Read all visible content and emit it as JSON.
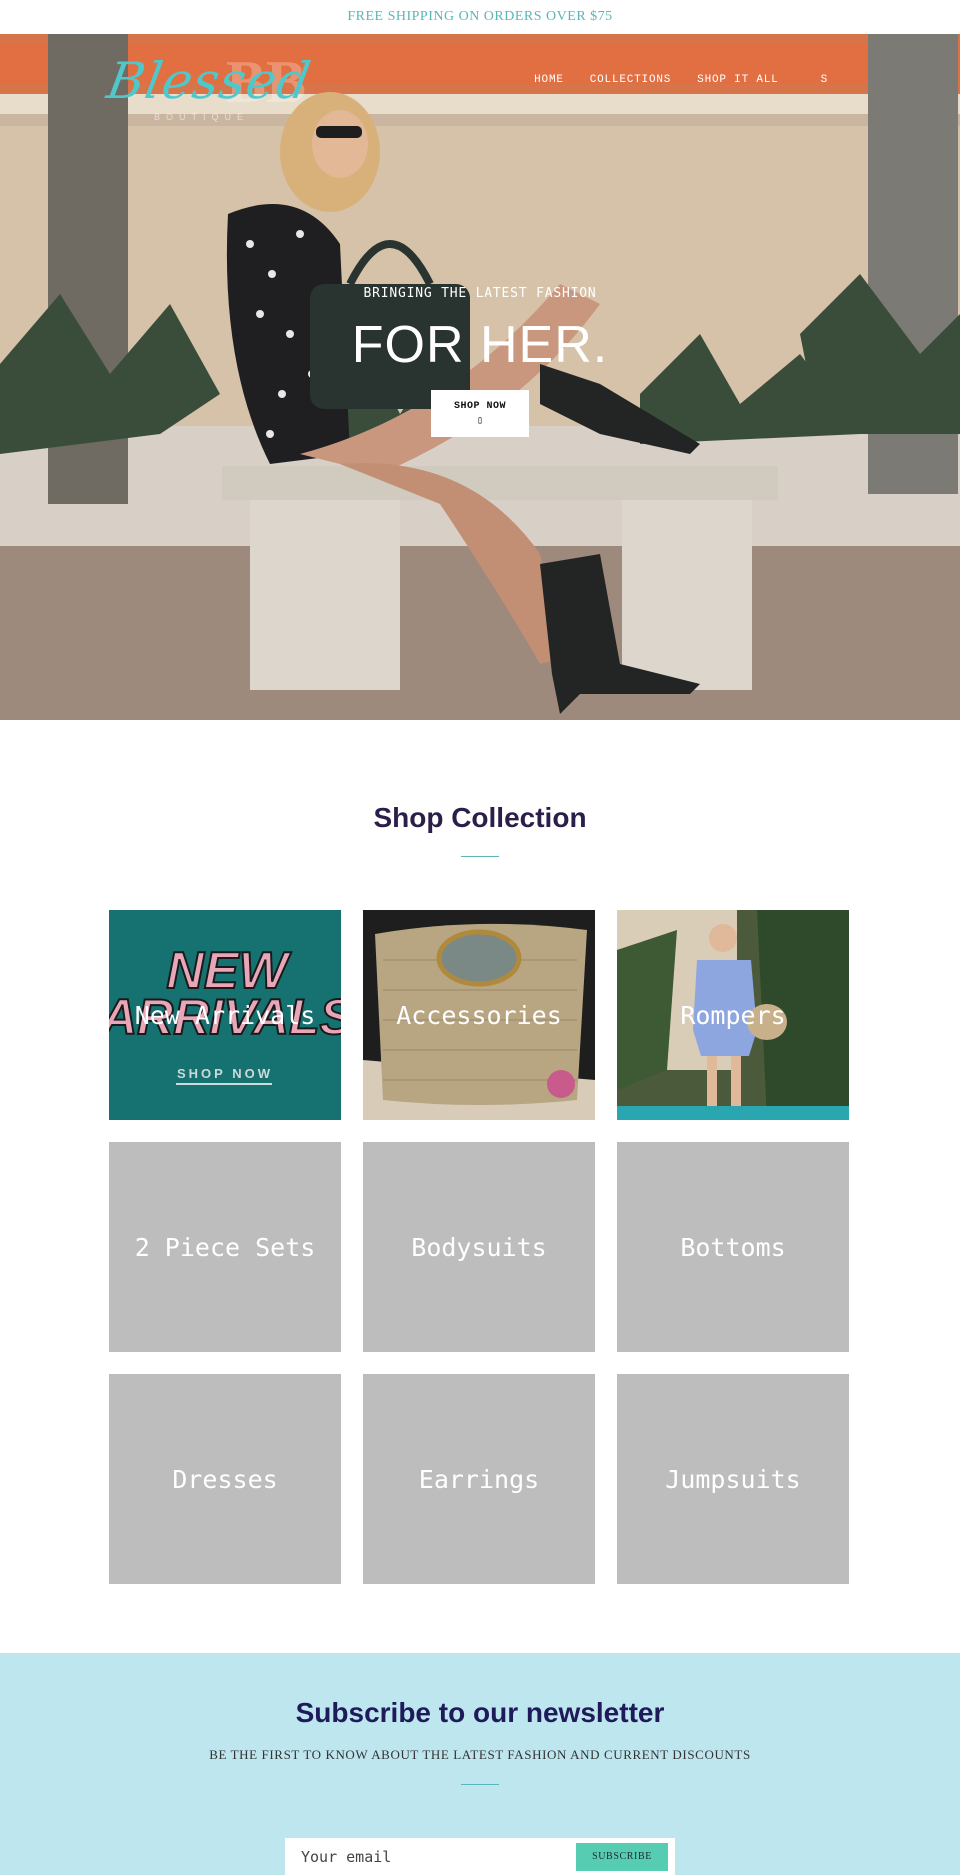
{
  "announcement": {
    "text": "FREE SHIPPING ON ORDERS OVER $75"
  },
  "header": {
    "logo": {
      "script": "Blessed",
      "sub": "BOUTIQUE"
    },
    "nav": [
      {
        "label": "HOME"
      },
      {
        "label": "COLLECTIONS"
      },
      {
        "label": "SHOP IT ALL"
      }
    ],
    "search_label": "S"
  },
  "hero": {
    "eyebrow": "BRINGING THE LATEST FASHION",
    "headline": "FOR HER.",
    "cta": {
      "label": "SHOP NOW",
      "icon": "right-arrow-icon",
      "glyph": "▯"
    }
  },
  "collections": {
    "title": "Shop Collection",
    "items": [
      {
        "label": "New Arrivals",
        "image": "new-arrivals-banner",
        "image_text": [
          "NEW",
          "ARRIVALS",
          "SHOP NOW"
        ]
      },
      {
        "label": "Accessories",
        "image": "woven-handbag-photo"
      },
      {
        "label": "Rompers",
        "image": "blue-romper-photo"
      },
      {
        "label": "2 Piece Sets"
      },
      {
        "label": "Bodysuits"
      },
      {
        "label": "Bottoms"
      },
      {
        "label": "Dresses"
      },
      {
        "label": "Earrings"
      },
      {
        "label": "Jumpsuits"
      }
    ]
  },
  "newsletter": {
    "title": "Subscribe to our newsletter",
    "subtitle": "BE THE FIRST TO KNOW ABOUT THE LATEST FASHION AND CURRENT DISCOUNTS",
    "email_placeholder": "Your email",
    "button_label": "SUBSCRIBE"
  },
  "colors": {
    "accent_teal": "#5ab6b6",
    "newsletter_bg": "#bde6ef",
    "subscribe_button": "#56cdb3",
    "tile_placeholder": "#bdbdbd",
    "heading": "#2b1f4a"
  }
}
